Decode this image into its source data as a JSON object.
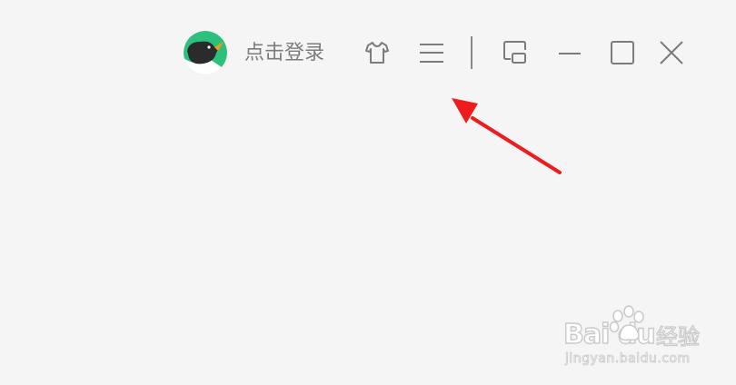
{
  "titlebar": {
    "login_label": "点击登录",
    "icons": {
      "avatar": "bird-avatar-icon",
      "skin": "tshirt-icon",
      "menu": "hamburger-menu-icon",
      "mini_mode": "mini-mode-icon",
      "minimize": "minimize-icon",
      "maximize": "maximize-icon",
      "close": "close-icon"
    }
  },
  "watermark": {
    "brand": "Bai du",
    "product": "经验",
    "url": "jingyan.baidu.com"
  },
  "colors": {
    "background": "#f5f5f5",
    "icon": "#7c7c7c",
    "avatar_green": "#2dbf7c",
    "arrow": "#ee1c1c"
  }
}
